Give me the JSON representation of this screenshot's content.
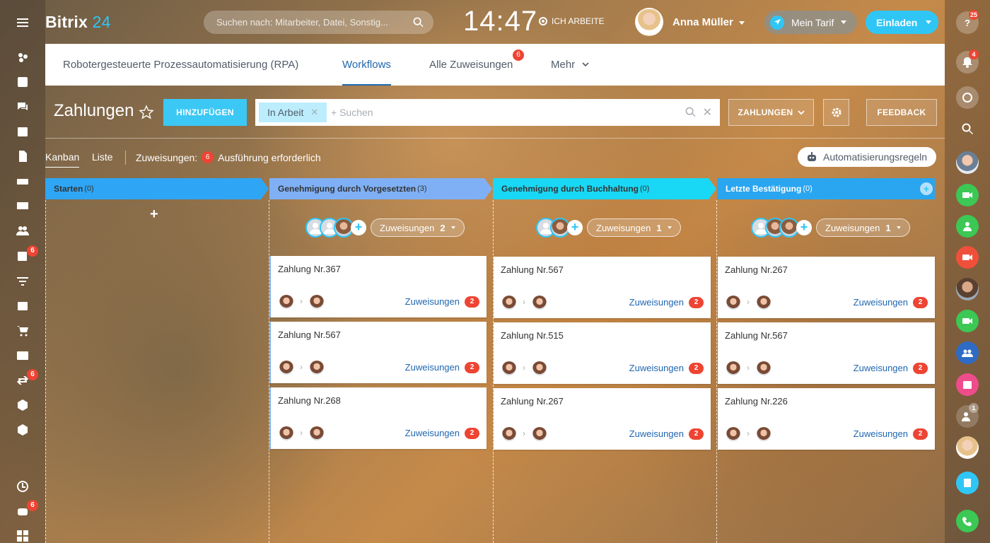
{
  "header": {
    "logo_name": "Bitrix",
    "logo_num": "24",
    "search_placeholder": "Suchen nach: Mitarbeiter, Datei, Sonstig...",
    "time": "14:47",
    "work_status": "ICH ARBEITE",
    "user_name": "Anna Müller",
    "tarif_label": "Mein Tarif",
    "invite_label": "Einladen",
    "help_badge": "25"
  },
  "tabs": [
    {
      "label": "Robotergesteuerte Prozessautomatisierung (RPA)"
    },
    {
      "label": "Workflows"
    },
    {
      "label": "Alle Zuweisungen",
      "badge": "6"
    },
    {
      "label": "Mehr"
    }
  ],
  "toolbar": {
    "title": "Zahlungen",
    "add_label": "HINZUFÜGEN",
    "filter_chip": "In Arbeit",
    "filter_placeholder": "+ Suchen",
    "category_label": "ZAHLUNGEN",
    "feedback_label": "FEEDBACK"
  },
  "views": {
    "kanban": "Kanban",
    "liste": "Liste",
    "counter_label": "Zuweisungen:",
    "counter_value": "6",
    "counter_text": "Ausführung erforderlich",
    "rules_label": "Automatisierungsregeln"
  },
  "left_sidebar": {
    "badges": {
      "tasks": "6",
      "flows": "6",
      "bottom": "6"
    }
  },
  "right_sidebar": {
    "badges": {
      "notifications": "4",
      "group": "1"
    }
  },
  "columns": [
    {
      "title": "Starten",
      "count": "(0)",
      "color": "#2fa6f5"
    },
    {
      "title": "Genehmigung durch Vorgesetzten",
      "count": "(3)",
      "color": "#7fb0f5",
      "assign_label": "Zuweisungen",
      "assign_count": "2",
      "cards": [
        {
          "title": "Zahlung Nr.367",
          "link": "Zuweisungen",
          "badge": "2"
        },
        {
          "title": "Zahlung Nr.567",
          "link": "Zuweisungen",
          "badge": "2"
        },
        {
          "title": "Zahlung Nr.268",
          "link": "Zuweisungen",
          "badge": "2"
        }
      ]
    },
    {
      "title": "Genehmigung durch Buchhaltung",
      "count": "(0)",
      "color": "#19d8f5",
      "assign_label": "Zuweisungen",
      "assign_count": "1",
      "cards": [
        {
          "title": "Zahlung Nr.567",
          "link": "Zuweisungen",
          "badge": "2"
        },
        {
          "title": "Zahlung Nr.515",
          "link": "Zuweisungen",
          "badge": "2"
        },
        {
          "title": "Zahlung Nr.267",
          "link": "Zuweisungen",
          "badge": "2"
        }
      ]
    },
    {
      "title": "Letzte Bestätigung",
      "count": "(0)",
      "color": "#2aa5f0",
      "assign_label": "Zuweisungen",
      "assign_count": "1",
      "cards": [
        {
          "title": "Zahlung Nr.267",
          "link": "Zuweisungen",
          "badge": "2"
        },
        {
          "title": "Zahlung Nr.567",
          "link": "Zuweisungen",
          "badge": "2"
        },
        {
          "title": "Zahlung Nr.226",
          "link": "Zuweisungen",
          "badge": "2"
        }
      ]
    }
  ]
}
